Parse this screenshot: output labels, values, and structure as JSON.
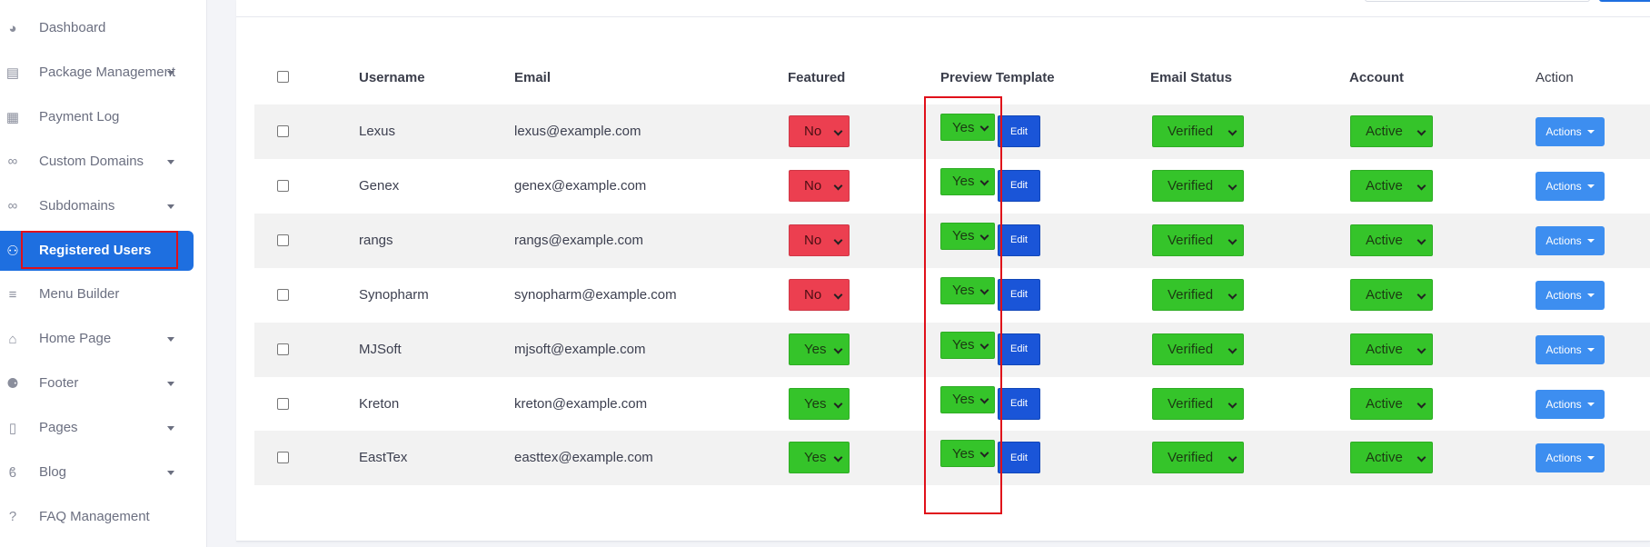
{
  "sidebar": {
    "items": [
      {
        "label": "Dashboard",
        "icon": "palette-icon",
        "has_caret": false,
        "active": false
      },
      {
        "label": "Package Management",
        "icon": "receipt-icon",
        "has_caret": true,
        "active": false
      },
      {
        "label": "Payment Log",
        "icon": "file-invoice-icon",
        "has_caret": false,
        "active": false
      },
      {
        "label": "Custom Domains",
        "icon": "link-icon",
        "has_caret": true,
        "active": false
      },
      {
        "label": "Subdomains",
        "icon": "link-icon",
        "has_caret": true,
        "active": false
      },
      {
        "label": "Registered Users",
        "icon": "users-icon",
        "has_caret": false,
        "active": true
      },
      {
        "label": "Menu Builder",
        "icon": "bars-icon",
        "has_caret": false,
        "active": false
      },
      {
        "label": "Home Page",
        "icon": "home-icon",
        "has_caret": true,
        "active": false
      },
      {
        "label": "Footer",
        "icon": "shoe-prints-icon",
        "has_caret": true,
        "active": false
      },
      {
        "label": "Pages",
        "icon": "file-icon",
        "has_caret": true,
        "active": false
      },
      {
        "label": "Blog",
        "icon": "blog-icon",
        "has_caret": true,
        "active": false
      },
      {
        "label": "FAQ Management",
        "icon": "question-circle-icon",
        "has_caret": false,
        "active": false
      }
    ]
  },
  "table": {
    "headers": {
      "username": "Username",
      "email": "Email",
      "featured": "Featured",
      "preview_template": "Preview Template",
      "email_status": "Email Status",
      "account": "Account",
      "action": "Action"
    },
    "edit_label": "Edit",
    "actions_label": "Actions",
    "rows": [
      {
        "username": "Lexus",
        "email": "lexus@example.com",
        "featured": "No",
        "preview": "Yes",
        "email_status": "Verified",
        "account": "Active"
      },
      {
        "username": "Genex",
        "email": "genex@example.com",
        "featured": "No",
        "preview": "Yes",
        "email_status": "Verified",
        "account": "Active"
      },
      {
        "username": "rangs",
        "email": "rangs@example.com",
        "featured": "No",
        "preview": "Yes",
        "email_status": "Verified",
        "account": "Active"
      },
      {
        "username": "Synopharm",
        "email": "synopharm@example.com",
        "featured": "No",
        "preview": "Yes",
        "email_status": "Verified",
        "account": "Active"
      },
      {
        "username": "MJSoft",
        "email": "mjsoft@example.com",
        "featured": "Yes",
        "preview": "Yes",
        "email_status": "Verified",
        "account": "Active"
      },
      {
        "username": "Kreton",
        "email": "kreton@example.com",
        "featured": "Yes",
        "preview": "Yes",
        "email_status": "Verified",
        "account": "Active"
      },
      {
        "username": "EastTex",
        "email": "easttex@example.com",
        "featured": "Yes",
        "preview": "Yes",
        "email_status": "Verified",
        "account": "Active"
      }
    ]
  },
  "colors": {
    "primary": "#1e6fe0",
    "green_select": "#35c42a",
    "red_select": "#ec3f50",
    "edit_button": "#1a55d8",
    "actions_button": "#3d8ef0",
    "highlight": "#e0101a"
  }
}
